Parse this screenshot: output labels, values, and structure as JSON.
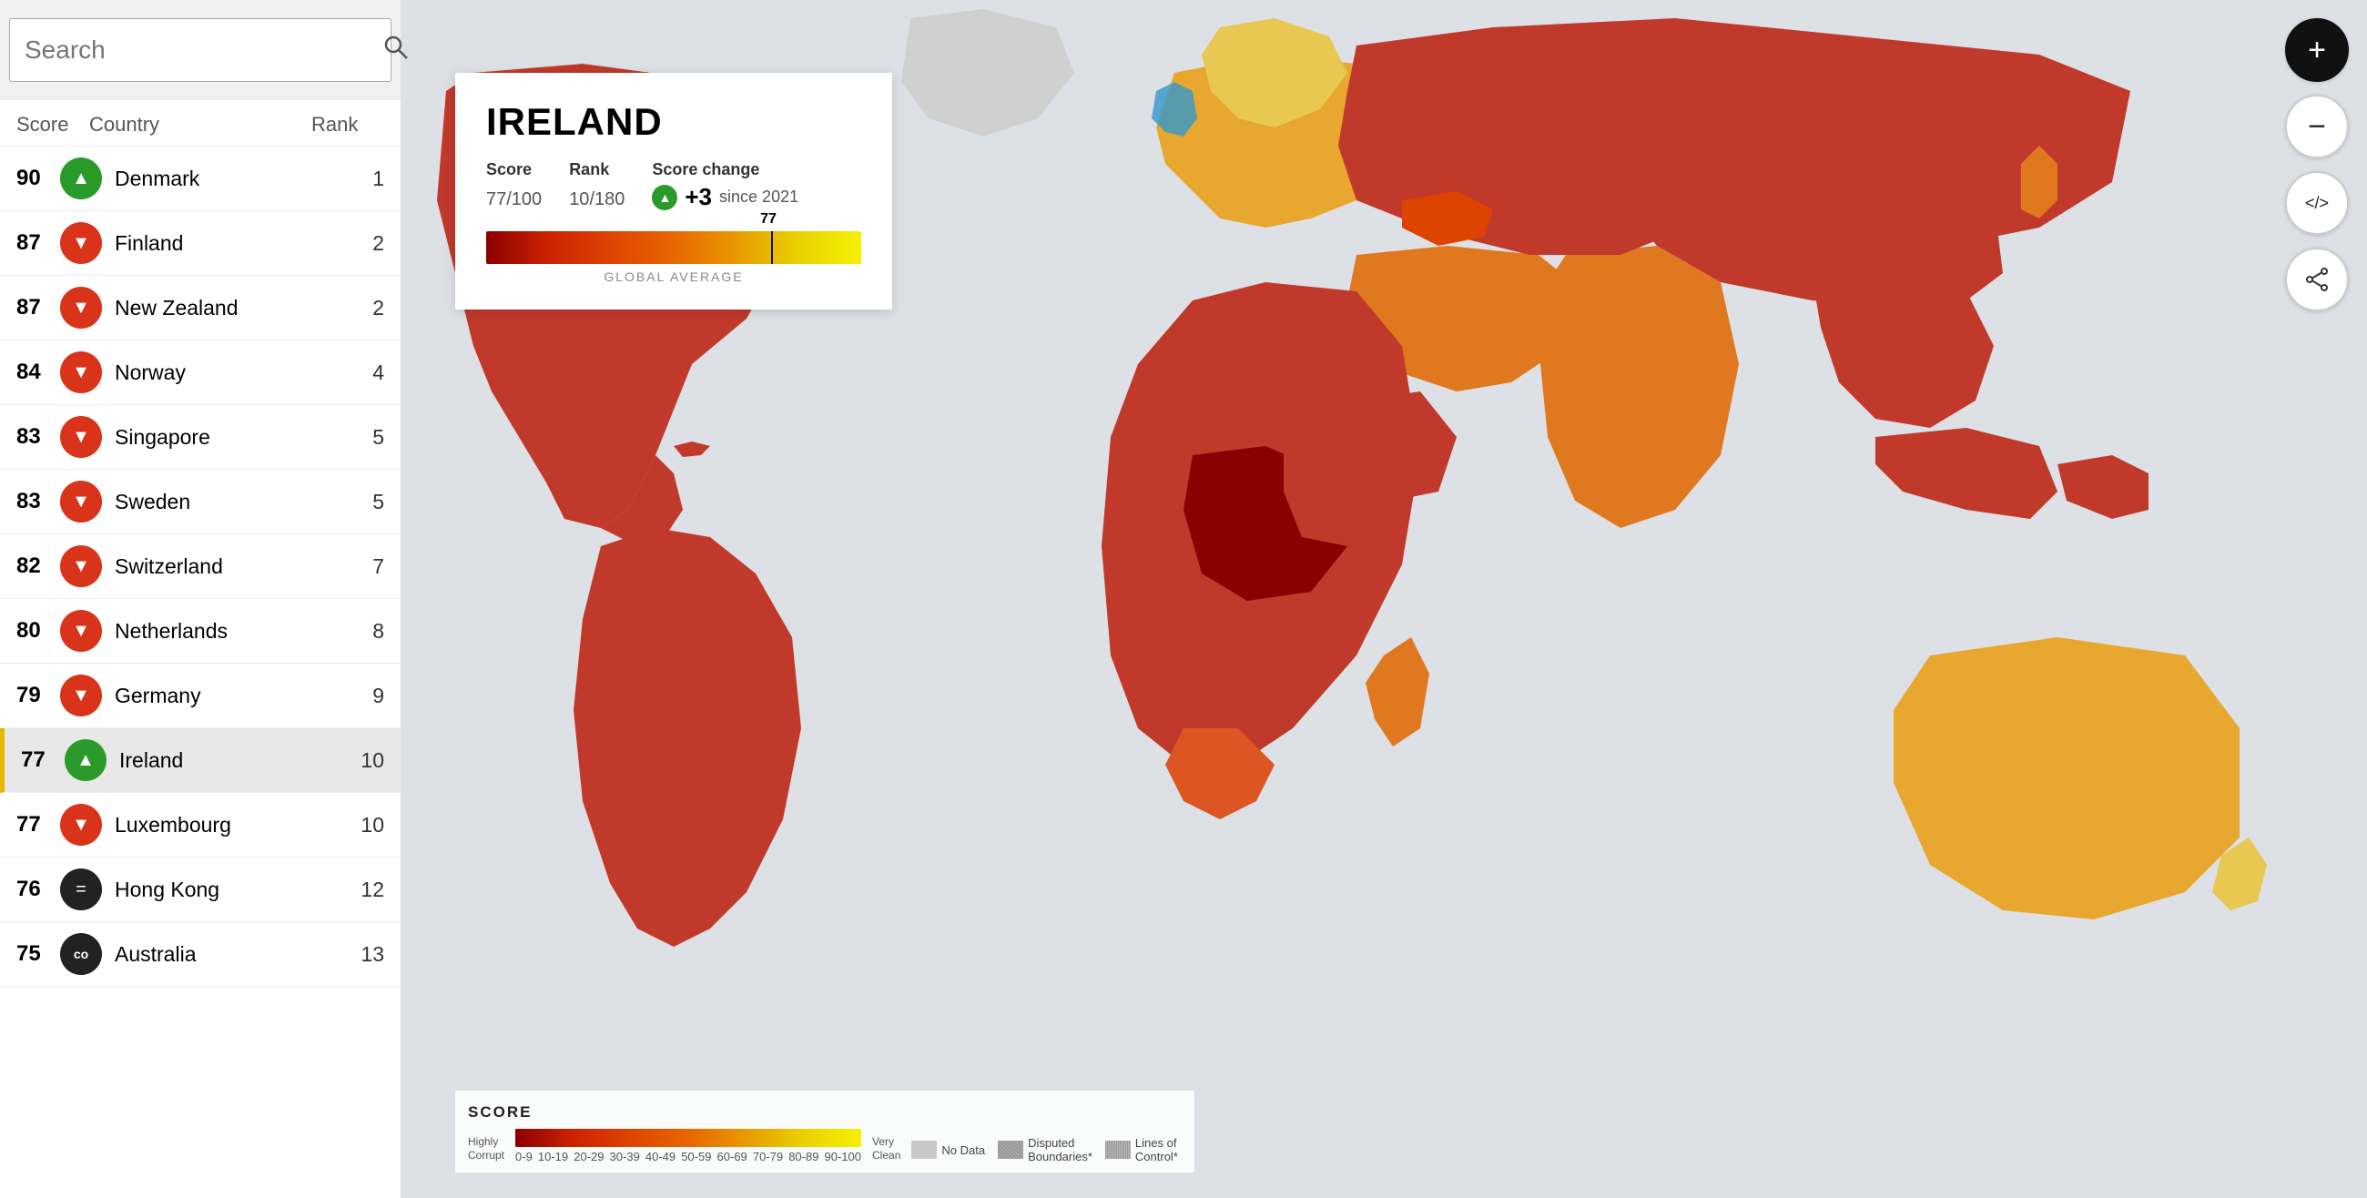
{
  "search": {
    "placeholder": "Search",
    "label": "Search"
  },
  "sidebar": {
    "headers": {
      "score": "Score",
      "country": "Country",
      "rank": "Rank"
    },
    "countries": [
      {
        "score": 90,
        "trend": "up",
        "name": "Denmark",
        "rank": 1,
        "active": false
      },
      {
        "score": 87,
        "trend": "down",
        "name": "Finland",
        "rank": 2,
        "active": false
      },
      {
        "score": 87,
        "trend": "down",
        "name": "New Zealand",
        "rank": 2,
        "active": false
      },
      {
        "score": 84,
        "trend": "down",
        "name": "Norway",
        "rank": 4,
        "active": false
      },
      {
        "score": 83,
        "trend": "down",
        "name": "Singapore",
        "rank": 5,
        "active": false
      },
      {
        "score": 83,
        "trend": "down",
        "name": "Sweden",
        "rank": 5,
        "active": false
      },
      {
        "score": 82,
        "trend": "down",
        "name": "Switzerland",
        "rank": 7,
        "active": false
      },
      {
        "score": 80,
        "trend": "down",
        "name": "Netherlands",
        "rank": 8,
        "active": false
      },
      {
        "score": 79,
        "trend": "down",
        "name": "Germany",
        "rank": 9,
        "active": false
      },
      {
        "score": 77,
        "trend": "up",
        "name": "Ireland",
        "rank": 10,
        "active": true
      },
      {
        "score": 77,
        "trend": "down",
        "name": "Luxembourg",
        "rank": 10,
        "active": false
      },
      {
        "score": 76,
        "trend": "equal",
        "name": "Hong Kong",
        "rank": 12,
        "active": false
      },
      {
        "score": 75,
        "trend": "logo",
        "name": "Australia",
        "rank": 13,
        "active": false
      }
    ]
  },
  "popup": {
    "country": "IRELAND",
    "score_value": "77",
    "score_max": "100",
    "rank_value": "10",
    "rank_max": "180",
    "score_change_label": "Score change",
    "change_amount": "+3",
    "change_since": "since 2021",
    "bar_score": 77,
    "bar_marker_label": "77",
    "global_avg_label": "GLOBAL AVERAGE",
    "score_label": "Score",
    "rank_label": "Rank"
  },
  "legend": {
    "title": "SCORE",
    "left_label": "Highly\nCorrupt",
    "right_label": "Very\nClean",
    "scale_labels": [
      "0-9",
      "10-19",
      "20-29",
      "30-39",
      "40-49",
      "50-59",
      "60-69",
      "70-79",
      "80-89",
      "90-100"
    ],
    "no_data_label": "No Data",
    "disputed_label": "Disputed\nBoundaries*",
    "lines_label": "Lines of\nControl*"
  },
  "controls": {
    "zoom_in": "+",
    "zoom_out": "−",
    "embed": "</>",
    "share": "↗"
  }
}
